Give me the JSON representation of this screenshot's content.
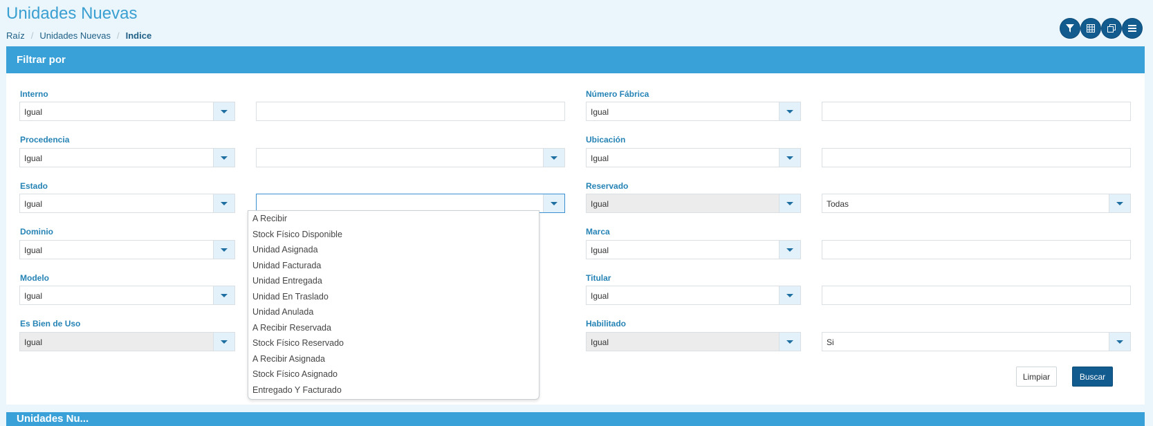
{
  "page": {
    "title": "Unidades Nuevas"
  },
  "breadcrumb": {
    "items": [
      "Raíz",
      "Unidades Nuevas",
      "Indice"
    ]
  },
  "toolbar": {
    "icons": [
      "filter-icon",
      "table-icon",
      "copy-icon",
      "menu-icon"
    ]
  },
  "panel": {
    "title": "Filtrar por"
  },
  "filters": {
    "interno": {
      "label": "Interno",
      "operator": "Igual",
      "value": ""
    },
    "procedencia": {
      "label": "Procedencia",
      "operator": "Igual",
      "value": ""
    },
    "estado": {
      "label": "Estado",
      "operator": "Igual",
      "value": ""
    },
    "dominio": {
      "label": "Dominio",
      "operator": "Igual"
    },
    "modelo": {
      "label": "Modelo",
      "operator": "Igual"
    },
    "es_bien_de_uso": {
      "label": "Es Bien de Uso",
      "operator": "Igual"
    },
    "numero_fabrica": {
      "label": "Número Fábrica",
      "operator": "Igual",
      "value": ""
    },
    "ubicacion": {
      "label": "Ubicación",
      "operator": "Igual",
      "value": ""
    },
    "reservado": {
      "label": "Reservado",
      "operator": "Igual",
      "value": "Todas"
    },
    "marca": {
      "label": "Marca",
      "operator": "Igual",
      "value": ""
    },
    "titular": {
      "label": "Titular",
      "operator": "Igual",
      "value": ""
    },
    "habilitado": {
      "label": "Habilitado",
      "operator": "Igual",
      "value": "Si"
    }
  },
  "estado_dropdown": {
    "options": [
      "A Recibir",
      "Stock Físico Disponible",
      "Unidad Asignada",
      "Unidad Facturada",
      "Unidad Entregada",
      "Unidad En Traslado",
      "Unidad Anulada",
      "A Recibir Reservada",
      "Stock Físico Reservado",
      "A Recibir Asignada",
      "Stock Físico Asignado",
      "Entregado Y Facturado"
    ]
  },
  "actions": {
    "clear_label": "Limpiar",
    "search_label": "Buscar"
  },
  "results": {
    "title": "Unidades Nu..."
  },
  "colors": {
    "accent": "#3aa1d8",
    "primary_button": "#125b8f",
    "label": "#2583b5"
  }
}
